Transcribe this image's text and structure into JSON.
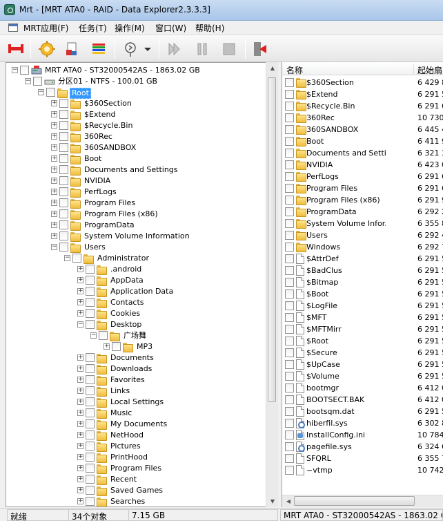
{
  "window": {
    "title": "Mrt - [MRT ATA0 - RAID - Data Explorer2.3.3.3]"
  },
  "menu": [
    "MRT应用(F)",
    "任务(T)",
    "操作(M)",
    "窗口(W)",
    "帮助(H)"
  ],
  "toolbar": {
    "icons": [
      "disk-connect-icon",
      "gear-settings-icon",
      "document-tools-icon",
      "color-bars-icon",
      "wizard-dropdown-icon",
      "play-icon",
      "pause-icon",
      "stop-icon",
      "exit-icon"
    ]
  },
  "tree": {
    "disk": "MRT ATA0 - ST32000542AS - 1863.02 GB",
    "partition": "分区01 - NTFS - 100.01 GB",
    "root": "Root",
    "root_children": [
      "$360Section",
      "$Extend",
      "$Recycle.Bin",
      "360Rec",
      "360SANDBOX",
      "Boot",
      "Documents and Settings",
      "NVIDIA",
      "PerfLogs",
      "Program Files",
      "Program Files (x86)",
      "ProgramData",
      "System Volume Information",
      "Users"
    ],
    "users_child": "Administrator",
    "admin_children_top": [
      ".android",
      "AppData",
      "Application Data",
      "Contacts",
      "Cookies",
      "Desktop"
    ],
    "desktop_child": "广场舞",
    "guangchang_child": "MP3",
    "admin_children_bottom": [
      "Documents",
      "Downloads",
      "Favorites",
      "Links",
      "Local Settings",
      "Music",
      "My Documents",
      "NetHood",
      "Pictures",
      "PrintHood",
      "Program Files",
      "Recent",
      "Saved Games",
      "Searches"
    ]
  },
  "list": {
    "columns": [
      "名称",
      "起始扇"
    ],
    "rows": [
      {
        "name": "$360Section",
        "start": "6 429 8",
        "icon": "folder"
      },
      {
        "name": "$Extend",
        "start": "6 291 5",
        "icon": "folder"
      },
      {
        "name": "$Recycle.Bin",
        "start": "6 291 6",
        "icon": "folder"
      },
      {
        "name": "360Rec",
        "start": "10 730 9",
        "icon": "folder"
      },
      {
        "name": "360SANDBOX",
        "start": "6 445 4",
        "icon": "folder"
      },
      {
        "name": "Boot",
        "start": "6 411 9",
        "icon": "folder"
      },
      {
        "name": "Documents and Setti...",
        "start": "6 321 3",
        "icon": "folder"
      },
      {
        "name": "NVIDIA",
        "start": "6 423 0",
        "icon": "folder"
      },
      {
        "name": "PerfLogs",
        "start": "6 291 6",
        "icon": "folder"
      },
      {
        "name": "Program Files",
        "start": "6 291 6",
        "icon": "folder"
      },
      {
        "name": "Program Files (x86)",
        "start": "6 291 9",
        "icon": "folder"
      },
      {
        "name": "ProgramData",
        "start": "6 292 2",
        "icon": "folder"
      },
      {
        "name": "System Volume Infor...",
        "start": "6 355 8",
        "icon": "folder"
      },
      {
        "name": "Users",
        "start": "6 292 4",
        "icon": "folder"
      },
      {
        "name": "Windows",
        "start": "6 292 7",
        "icon": "folder"
      },
      {
        "name": "$AttrDef",
        "start": "6 291 5",
        "icon": "file"
      },
      {
        "name": "$BadClus",
        "start": "6 291 5",
        "icon": "file"
      },
      {
        "name": "$Bitmap",
        "start": "6 291 5",
        "icon": "file"
      },
      {
        "name": "$Boot",
        "start": "6 291 5",
        "icon": "file"
      },
      {
        "name": "$LogFile",
        "start": "6 291 5",
        "icon": "file"
      },
      {
        "name": "$MFT",
        "start": "6 291 5",
        "icon": "file"
      },
      {
        "name": "$MFTMirr",
        "start": "6 291 5",
        "icon": "file"
      },
      {
        "name": "$Root",
        "start": "6 291 5",
        "icon": "file"
      },
      {
        "name": "$Secure",
        "start": "6 291 5",
        "icon": "file"
      },
      {
        "name": "$UpCase",
        "start": "6 291 5",
        "icon": "file"
      },
      {
        "name": "$Volume",
        "start": "6 291 5",
        "icon": "file"
      },
      {
        "name": "bootmgr",
        "start": "6 412 0",
        "icon": "file"
      },
      {
        "name": "BOOTSECT.BAK",
        "start": "6 412 0",
        "icon": "file"
      },
      {
        "name": "bootsqm.dat",
        "start": "6 291 5",
        "icon": "file"
      },
      {
        "name": "hiberfil.sys",
        "start": "6 302 8",
        "icon": "gear-file"
      },
      {
        "name": "InstallConfig.ini",
        "start": "10 784 6",
        "icon": "cfg-file"
      },
      {
        "name": "pagefile.sys",
        "start": "6 324 6",
        "icon": "gear-file"
      },
      {
        "name": "SFQRL",
        "start": "6 355 7",
        "icon": "file"
      },
      {
        "name": "~vtmp",
        "start": "10 742 6",
        "icon": "file"
      }
    ]
  },
  "status": {
    "state": "就绪",
    "count": "34个对象",
    "size": "7.15 GB",
    "disk": "MRT ATA0 - ST32000542AS - 1863.02 GB"
  }
}
